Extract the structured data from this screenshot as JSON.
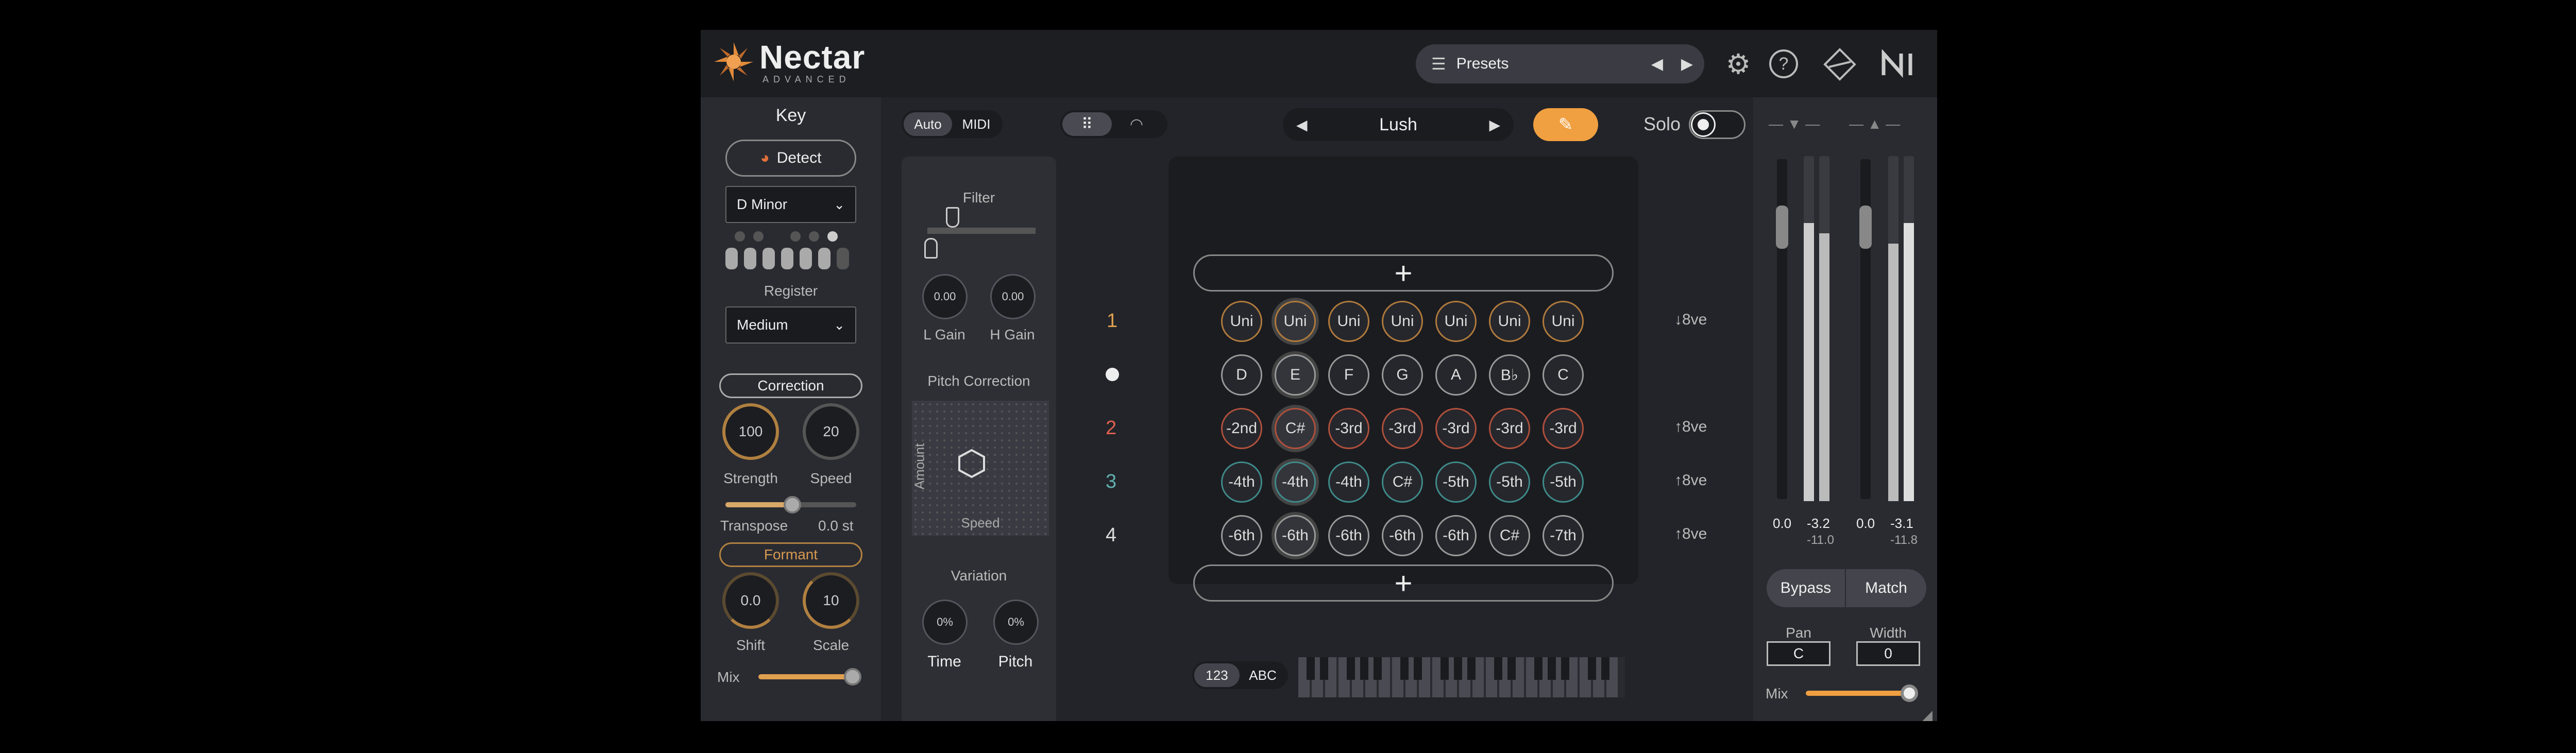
{
  "app": {
    "name": "Nectar",
    "subtitle": "ADVANCED"
  },
  "header": {
    "presets_label": "Presets"
  },
  "key": {
    "title": "Key",
    "detect": "Detect",
    "scale": "D Minor",
    "register_label": "Register",
    "register": "Medium"
  },
  "correction": {
    "title": "Correction",
    "strength": "100",
    "speed": "20",
    "strength_label": "Strength",
    "speed_label": "Speed",
    "transpose_label": "Transpose",
    "transpose": "0.0 st"
  },
  "formant": {
    "title": "Formant",
    "shift": "0.0",
    "scale": "10",
    "shift_label": "Shift",
    "scale_label": "Scale"
  },
  "mix_left_label": "Mix",
  "mode": {
    "auto": "Auto",
    "midi": "MIDI"
  },
  "filter": {
    "title": "Filter",
    "l_gain": "0.00",
    "h_gain": "0.00",
    "l_label": "L Gain",
    "h_label": "H Gain"
  },
  "pitch": {
    "title": "Pitch Correction",
    "amount": "Amount",
    "speed": "Speed"
  },
  "variation": {
    "title": "Variation",
    "time": "0%",
    "pitch": "0%",
    "time_label": "Time",
    "pitch_label": "Pitch"
  },
  "style": {
    "name": "Lush"
  },
  "solo": "Solo",
  "rows": {
    "numbers": [
      "1",
      "2",
      "3",
      "4"
    ],
    "r1": [
      "Uni",
      "Uni",
      "Uni",
      "Uni",
      "Uni",
      "Uni",
      "Uni"
    ],
    "r2": [
      "D",
      "E",
      "F",
      "G",
      "A",
      "B♭",
      "C"
    ],
    "r3": [
      "-2nd",
      "C#",
      "-3rd",
      "-3rd",
      "-3rd",
      "-3rd",
      "-3rd"
    ],
    "r4": [
      "-4th",
      "-4th",
      "-4th",
      "C#",
      "-5th",
      "-5th",
      "-5th"
    ],
    "r5": [
      "-6th",
      "-6th",
      "-6th",
      "-6th",
      "-6th",
      "C#",
      "-7th"
    ],
    "octaves": [
      "8ve",
      "8ve",
      "8ve",
      "8ve"
    ]
  },
  "plus": "+",
  "notation": {
    "num": "123",
    "abc": "ABC"
  },
  "meters": {
    "l1": "0.0",
    "l2": "-3.2",
    "l3": "-11.0",
    "r1": "0.0",
    "r2": "-3.1",
    "r3": "-11.8"
  },
  "output": {
    "bypass": "Bypass",
    "match": "Match",
    "pan_label": "Pan",
    "pan": "C",
    "width_label": "Width",
    "width": "0",
    "mix_label": "Mix"
  }
}
